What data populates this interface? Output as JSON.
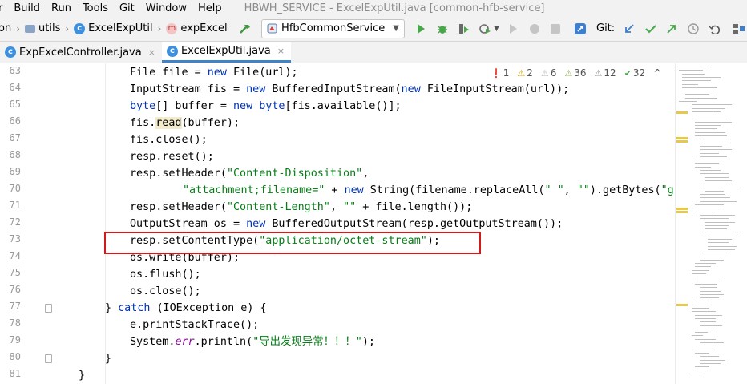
{
  "menu": {
    "items": [
      "r",
      "Build",
      "Run",
      "Tools",
      "Git",
      "Window",
      "Help"
    ],
    "window_title": "HBWH_SERVICE - ExcelExpUtil.java [common-hfb-service]"
  },
  "breadcrumb": {
    "items": [
      "on",
      "utils",
      "ExcelExpUtil",
      "expExcel"
    ]
  },
  "toolbar": {
    "run_config": "HfbCommonService",
    "git_label": "Git:"
  },
  "tabs": [
    {
      "label": "ExpExcelController.java",
      "close": "×"
    },
    {
      "label": "ExcelExpUtil.java",
      "close": "×"
    }
  ],
  "inspections": {
    "errors": "1",
    "warnings": "2",
    "weak_warnings": "6",
    "typos": "36",
    "info": "12",
    "ok": "32",
    "nav": "^"
  },
  "colors": {
    "keyword": "#0033b3",
    "string": "#067d17",
    "static_field": "#871094",
    "highlight_box": "#d11b1b",
    "active_tab": "#4083c9"
  },
  "code": {
    "line_numbers": [
      "63",
      "64",
      "65",
      "66",
      "67",
      "68",
      "69",
      "70",
      "71",
      "72",
      "73",
      "74",
      "75",
      "76",
      "77",
      "78",
      "79",
      "80",
      "81"
    ],
    "lines": [
      [
        [
          "",
          "File file = "
        ],
        [
          "kw",
          "new"
        ],
        [
          "",
          " File(url);"
        ]
      ],
      [
        [
          "",
          "InputStream fis = "
        ],
        [
          "kw",
          "new"
        ],
        [
          "",
          " BufferedInputStream("
        ],
        [
          "kw",
          "new"
        ],
        [
          "",
          " FileInputStream(url));"
        ]
      ],
      [
        [
          "kw",
          "byte"
        ],
        [
          "",
          "[] buffer = "
        ],
        [
          "kw",
          "new"
        ],
        [
          "",
          " "
        ],
        [
          "kw",
          "byte"
        ],
        [
          "",
          "[fis.available()];"
        ]
      ],
      [
        [
          "",
          "fis."
        ],
        [
          "hl",
          "read"
        ],
        [
          "",
          "(buffer);"
        ]
      ],
      [
        [
          "",
          "fis.close();"
        ]
      ],
      [
        [
          "",
          "resp.reset();"
        ]
      ],
      [
        [
          "",
          "resp.setHeader("
        ],
        [
          "str",
          "\"Content-Disposition\""
        ],
        [
          "",
          ","
        ]
      ],
      [
        [
          "str",
          "\"attachment;filename=\""
        ],
        [
          "",
          " + "
        ],
        [
          "kw",
          "new"
        ],
        [
          "",
          " String(filename.replaceAll("
        ],
        [
          "str",
          "\" \""
        ],
        [
          "",
          ", "
        ],
        [
          "str",
          "\"\""
        ],
        [
          "",
          ").getBytes("
        ],
        [
          "str",
          "\"gbk\""
        ]
      ],
      [
        [
          "",
          "resp.setHeader("
        ],
        [
          "str",
          "\"Content-Length\""
        ],
        [
          "",
          ", "
        ],
        [
          "str",
          "\"\""
        ],
        [
          "",
          " + file.length());"
        ]
      ],
      [
        [
          "",
          "OutputStream os = "
        ],
        [
          "kw",
          "new"
        ],
        [
          "",
          " BufferedOutputStream(resp.getOutputStream());"
        ]
      ],
      [
        [
          "",
          "resp.setContentType("
        ],
        [
          "str",
          "\"application/octet-stream\""
        ],
        [
          "",
          ");"
        ]
      ],
      [
        [
          "",
          "os.write(buffer);"
        ]
      ],
      [
        [
          "",
          "os.flush();"
        ]
      ],
      [
        [
          "",
          "os.close();"
        ]
      ],
      [
        [
          "",
          "} "
        ],
        [
          "kw",
          "catch"
        ],
        [
          "",
          " (IOException e) {"
        ]
      ],
      [
        [
          "",
          "e.printStackTrace();"
        ]
      ],
      [
        [
          "",
          "System."
        ],
        [
          "fld",
          "err"
        ],
        [
          "",
          ".println("
        ],
        [
          "str",
          "\"导出发现异常！！！\""
        ],
        [
          "",
          ");"
        ]
      ],
      [
        [
          "",
          "}"
        ]
      ],
      [
        [
          "",
          "}"
        ]
      ]
    ]
  }
}
